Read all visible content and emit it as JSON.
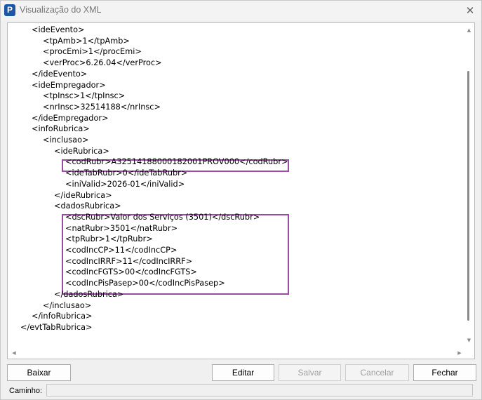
{
  "window": {
    "title": "Visualização do XML",
    "app_icon_letter": "P",
    "close_glyph": "✕"
  },
  "xml_lines": [
    {
      "indent": 0,
      "text": "<ideEvento>"
    },
    {
      "indent": 1,
      "text": "<tpAmb>1</tpAmb>"
    },
    {
      "indent": 1,
      "text": "<procEmi>1</procEmi>"
    },
    {
      "indent": 1,
      "text": "<verProc>6.26.04</verProc>"
    },
    {
      "indent": 0,
      "text": "</ideEvento>"
    },
    {
      "indent": 0,
      "text": "<ideEmpregador>"
    },
    {
      "indent": 1,
      "text": "<tpInsc>1</tpInsc>"
    },
    {
      "indent": 1,
      "text": "<nrInsc>32514188</nrInsc>"
    },
    {
      "indent": 0,
      "text": "</ideEmpregador>"
    },
    {
      "indent": 0,
      "text": "<infoRubrica>"
    },
    {
      "indent": 1,
      "text": "<inclusao>"
    },
    {
      "indent": 2,
      "text": "<ideRubrica>"
    },
    {
      "indent": 3,
      "text": "<codRubr>A32514188000182001PROV000</codRubr>"
    },
    {
      "indent": 3,
      "text": "<ideTabRubr>0</ideTabRubr>"
    },
    {
      "indent": 3,
      "text": "<iniValid>2026-01</iniValid>"
    },
    {
      "indent": 2,
      "text": "</ideRubrica>"
    },
    {
      "indent": 2,
      "text": "<dadosRubrica>"
    },
    {
      "indent": 3,
      "text": "<dscRubr>Valor dos Serviços (3501)</dscRubr>"
    },
    {
      "indent": 3,
      "text": "<natRubr>3501</natRubr>"
    },
    {
      "indent": 3,
      "text": "<tpRubr>1</tpRubr>"
    },
    {
      "indent": 3,
      "text": "<codIncCP>11</codIncCP>"
    },
    {
      "indent": 3,
      "text": "<codIncIRRF>11</codIncIRRF>"
    },
    {
      "indent": 3,
      "text": "<codIncFGTS>00</codIncFGTS>"
    },
    {
      "indent": 3,
      "text": "<codIncPisPasep>00</codIncPisPasep>"
    },
    {
      "indent": 2,
      "text": "</dadosRubrica>"
    },
    {
      "indent": 1,
      "text": "</inclusao>"
    },
    {
      "indent": 0,
      "text": "</infoRubrica>"
    },
    {
      "indent": -1,
      "text": "</evtTabRubrica>"
    }
  ],
  "buttons": {
    "baixar": {
      "label": "Baixar",
      "enabled": true
    },
    "editar": {
      "label": "Editar",
      "enabled": true
    },
    "salvar": {
      "label": "Salvar",
      "enabled": false
    },
    "cancelar": {
      "label": "Cancelar",
      "enabled": false
    },
    "fechar": {
      "label": "Fechar",
      "enabled": true
    }
  },
  "path": {
    "label": "Caminho:",
    "value": ""
  },
  "colors": {
    "highlight": "#9b4aa6",
    "app_icon": "#1d57a3"
  }
}
